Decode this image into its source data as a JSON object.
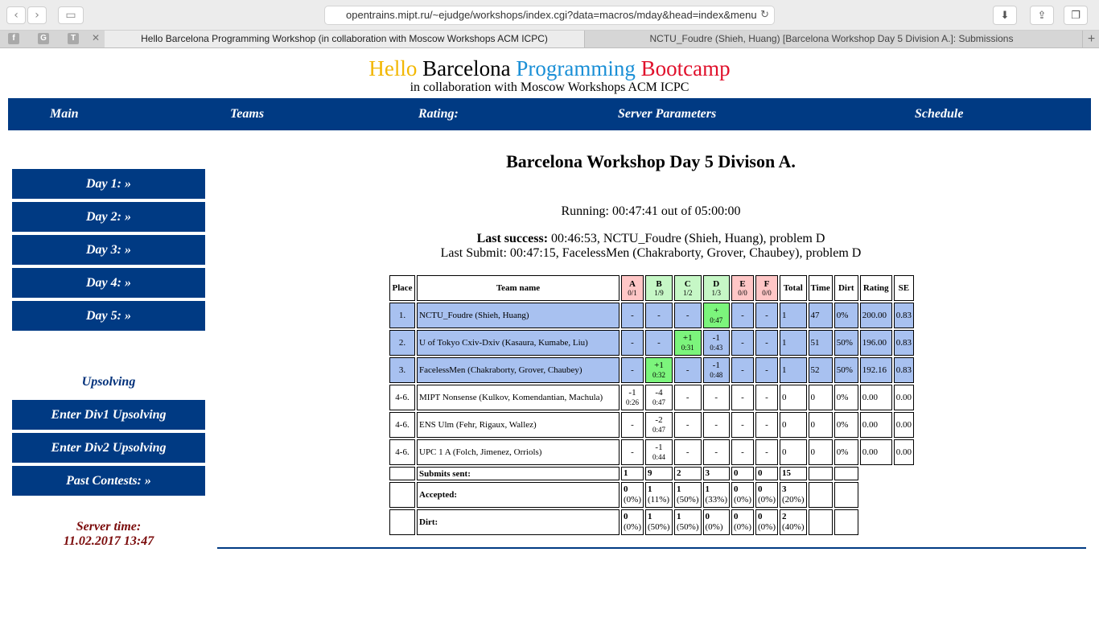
{
  "browser": {
    "url": "opentrains.mipt.ru/~ejudge/workshops/index.cgi?data=macros/mday&head=index&menu",
    "tabs": [
      "Hello Barcelona Programming Workshop (in collaboration with Moscow Workshops ACM ICPC)",
      "NCTU_Foudre (Shieh, Huang) [Barcelona Workshop Day 5 Division A.]: Submissions"
    ],
    "pinned": [
      "G",
      "T"
    ]
  },
  "brand": {
    "w1": "Hello",
    "w2": "Barcelona",
    "w3": "Programming",
    "w4": "Bootcamp",
    "subtitle": "in collaboration with Moscow Workshops ACM ICPC"
  },
  "nav": {
    "main": "Main",
    "teams": "Teams",
    "rating": "Rating:",
    "server": "Server Parameters",
    "schedule": "Schedule"
  },
  "sidebar": {
    "days": [
      "Day 1: »",
      "Day 2: »",
      "Day 3: »",
      "Day 4: »",
      "Day 5: »"
    ],
    "upsolving_title": "Upsolving",
    "upsolving": [
      "Enter Div1 Upsolving",
      "Enter Div2 Upsolving",
      "Past Contests: »"
    ],
    "server_time_label": "Server time:",
    "server_time": "11.02.2017 13:47"
  },
  "contest": {
    "title": "Barcelona Workshop Day 5 Divison A.",
    "running": "Running: 00:47:41 out of 05:00:00",
    "last_success_label": "Last success:",
    "last_success": " 00:46:53, NCTU_Foudre (Shieh, Huang), problem D",
    "last_submit": "Last Submit: 00:47:15, FacelessMen (Chakraborty, Grover, Chaubey), problem D"
  },
  "standings": {
    "headers": {
      "place": "Place",
      "team": "Team name",
      "total": "Total",
      "time": "Time",
      "dirt": "Dirt",
      "rating": "Rating",
      "se": "SE"
    },
    "problems": [
      {
        "name": "A",
        "stat": "0/1"
      },
      {
        "name": "B",
        "stat": "1/9"
      },
      {
        "name": "C",
        "stat": "1/2"
      },
      {
        "name": "D",
        "stat": "1/3"
      },
      {
        "name": "E",
        "stat": "0/0"
      },
      {
        "name": "F",
        "stat": "0/0"
      }
    ],
    "rows": [
      {
        "place": "1.",
        "team": "NCTU_Foudre (Shieh, Huang)",
        "cells": [
          [
            "-",
            ""
          ],
          [
            "-",
            ""
          ],
          [
            "-",
            ""
          ],
          [
            "+",
            "0:47"
          ],
          [
            "-",
            ""
          ],
          [
            "-",
            ""
          ]
        ],
        "total": "1",
        "time": "47",
        "dirt": "0%",
        "rating": "200.00",
        "se": "0.83"
      },
      {
        "place": "2.",
        "team": "U of Tokyo Cxiv-Dxiv (Kasaura, Kumabe, Liu)",
        "cells": [
          [
            "-",
            ""
          ],
          [
            "-",
            ""
          ],
          [
            "+1",
            "0:31"
          ],
          [
            "-1",
            "0:43"
          ],
          [
            "-",
            ""
          ],
          [
            "-",
            ""
          ]
        ],
        "total": "1",
        "time": "51",
        "dirt": "50%",
        "rating": "196.00",
        "se": "0.83"
      },
      {
        "place": "3.",
        "team": "FacelessMen (Chakraborty, Grover, Chaubey)",
        "cells": [
          [
            "-",
            ""
          ],
          [
            "+1",
            "0:32"
          ],
          [
            "-",
            ""
          ],
          [
            "-1",
            "0:48"
          ],
          [
            "-",
            ""
          ],
          [
            "-",
            ""
          ]
        ],
        "total": "1",
        "time": "52",
        "dirt": "50%",
        "rating": "192.16",
        "se": "0.83"
      },
      {
        "place": "4-6.",
        "team": "MIPT Nonsense (Kulkov, Komendantian, Machula)",
        "cells": [
          [
            "-1",
            "0:26"
          ],
          [
            "-4",
            "0:47"
          ],
          [
            "-",
            ""
          ],
          [
            "-",
            ""
          ],
          [
            "-",
            ""
          ],
          [
            "-",
            ""
          ]
        ],
        "total": "0",
        "time": "0",
        "dirt": "0%",
        "rating": "0.00",
        "se": "0.00"
      },
      {
        "place": "4-6.",
        "team": "ENS Ulm (Fehr, Rigaux, Wallez)",
        "cells": [
          [
            "-",
            ""
          ],
          [
            "-2",
            "0:47"
          ],
          [
            "-",
            ""
          ],
          [
            "-",
            ""
          ],
          [
            "-",
            ""
          ],
          [
            "-",
            ""
          ]
        ],
        "total": "0",
        "time": "0",
        "dirt": "0%",
        "rating": "0.00",
        "se": "0.00"
      },
      {
        "place": "4-6.",
        "team": "UPC 1 A (Folch, Jimenez, Orriols)",
        "cells": [
          [
            "-",
            ""
          ],
          [
            "-1",
            "0:44"
          ],
          [
            "-",
            ""
          ],
          [
            "-",
            ""
          ],
          [
            "-",
            ""
          ],
          [
            "-",
            ""
          ]
        ],
        "total": "0",
        "time": "0",
        "dirt": "0%",
        "rating": "0.00",
        "se": "0.00"
      }
    ],
    "summary": [
      {
        "label": "Submits sent:",
        "values": [
          [
            "1",
            ""
          ],
          [
            "9",
            ""
          ],
          [
            "2",
            ""
          ],
          [
            "3",
            ""
          ],
          [
            "0",
            ""
          ],
          [
            "0",
            ""
          ],
          [
            "15",
            ""
          ]
        ]
      },
      {
        "label": "Accepted:",
        "values": [
          [
            "0",
            "(0%)"
          ],
          [
            "1",
            "(11%)"
          ],
          [
            "1",
            "(50%)"
          ],
          [
            "1",
            "(33%)"
          ],
          [
            "0",
            "(0%)"
          ],
          [
            "0",
            "(0%)"
          ],
          [
            "3",
            "(20%)"
          ]
        ]
      },
      {
        "label": "Dirt:",
        "values": [
          [
            "0",
            "(0%)"
          ],
          [
            "1",
            "(50%)"
          ],
          [
            "1",
            "(50%)"
          ],
          [
            "0",
            "(0%)"
          ],
          [
            "0",
            "(0%)"
          ],
          [
            "0",
            "(0%)"
          ],
          [
            "2",
            "(40%)"
          ]
        ]
      }
    ]
  }
}
